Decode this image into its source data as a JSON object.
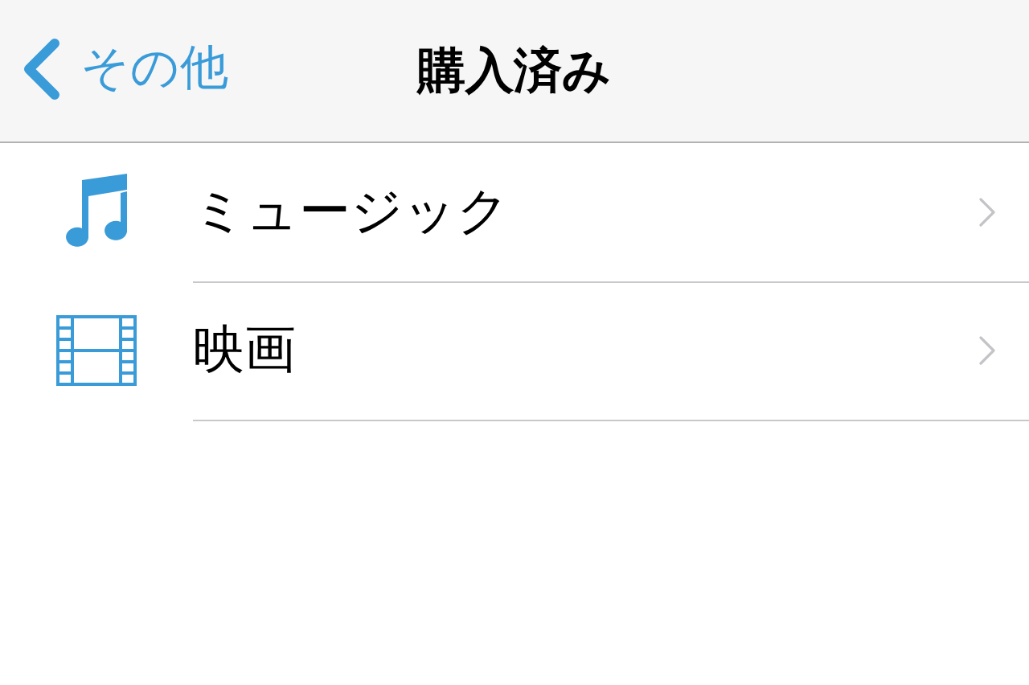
{
  "nav_bar": {
    "back_label": "その他",
    "title": "購入済み"
  },
  "items": [
    {
      "kind": "music",
      "label": "ミュージック"
    },
    {
      "kind": "film",
      "label": "映画"
    }
  ]
}
